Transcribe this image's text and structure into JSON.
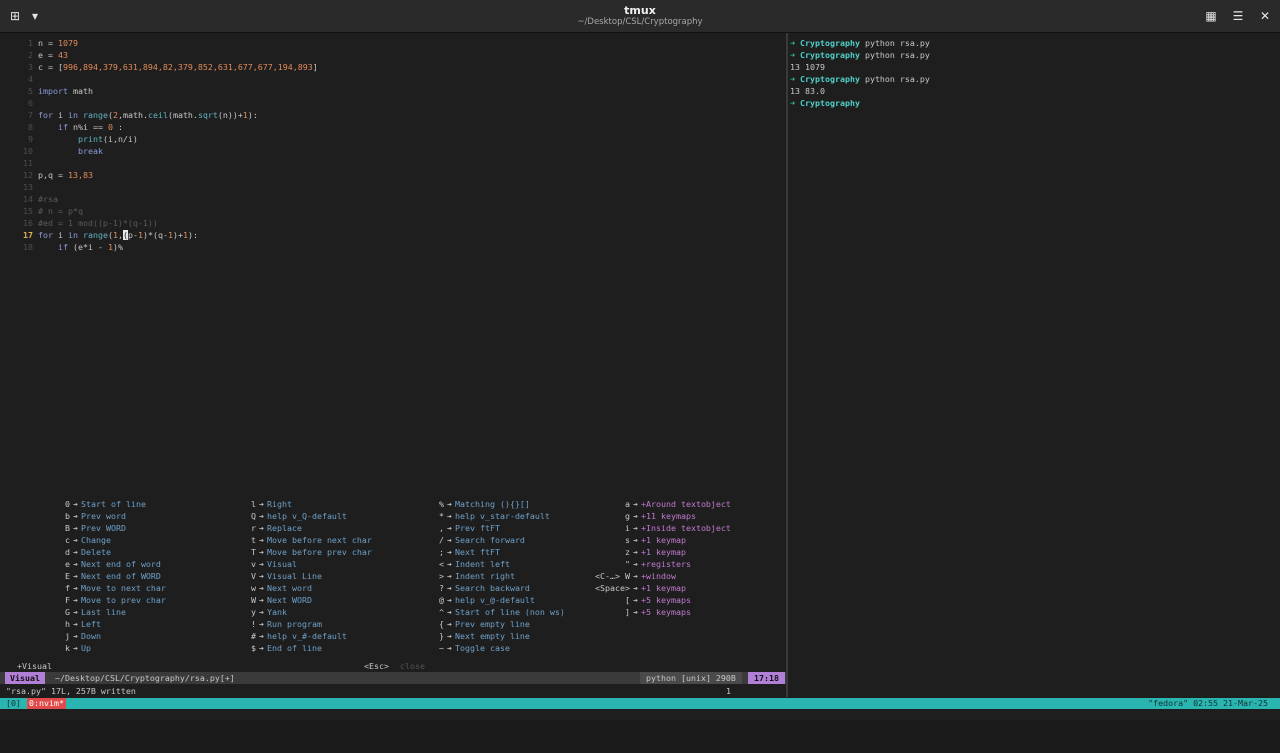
{
  "window": {
    "title": "tmux",
    "subtitle": "~/Desktop/CSL/Cryptography",
    "new_tab_icon": "plus-square-icon",
    "menu_icon": "chevron-down-icon",
    "grid_icon": "grid-icon",
    "hamburger_icon": "hamburger-icon",
    "close_icon": "close-icon",
    "new_tab_glyph": "⊞",
    "menu_glyph": "▾",
    "grid_glyph": "▦",
    "hamburger_glyph": "☰",
    "close_glyph": "✕"
  },
  "editor": {
    "lines": [
      {
        "num": "1",
        "html": "<span class='txt'>n = </span><span class='num'>1079</span>"
      },
      {
        "num": "2",
        "html": "<span class='txt'>e = </span><span class='num'>43</span>"
      },
      {
        "num": "3",
        "html": "<span class='txt'>c = [</span><span class='num'>996,894,379,631,894,82,379,852,631,677,677,194,893</span><span class='txt'>]</span>"
      },
      {
        "num": "4",
        "html": ""
      },
      {
        "num": "5",
        "html": "<span class='kw'>import</span><span class='txt'> math</span>"
      },
      {
        "num": "6",
        "html": ""
      },
      {
        "num": "7",
        "html": "<span class='kw'>for</span><span class='txt'> i </span><span class='kw'>in</span><span class='txt'> </span><span class='fn'>range</span><span class='txt'>(</span><span class='num'>2</span><span class='txt'>,math.</span><span class='fn'>ceil</span><span class='txt'>(math.</span><span class='fn'>sqrt</span><span class='txt'>(n))+</span><span class='num'>1</span><span class='txt'>):</span>"
      },
      {
        "num": "8",
        "html": "<span class='txt'>    </span><span class='kw'>if</span><span class='txt'> n%i == </span><span class='num'>0</span><span class='txt'> :</span>"
      },
      {
        "num": "9",
        "html": "<span class='txt'>        </span><span class='fn'>print</span><span class='txt'>(i,n/i)</span>"
      },
      {
        "num": "10",
        "html": "<span class='txt'>        </span><span class='kw'>break</span>"
      },
      {
        "num": "11",
        "html": ""
      },
      {
        "num": "12",
        "html": "<span class='txt'>p,q = </span><span class='num'>13,83</span>"
      },
      {
        "num": "13",
        "html": ""
      },
      {
        "num": "14",
        "html": "<span class='cm'>#rsa</span>"
      },
      {
        "num": "15",
        "html": "<span class='cm'># n = p*q</span>"
      },
      {
        "num": "16",
        "html": "<span class='cm'>#ed = 1 mod((p-1)*(q-1))</span>"
      },
      {
        "num": "17",
        "html": "<span class='kw'>for</span><span class='txt'> i </span><span class='kw'>in</span><span class='txt'> </span><span class='fn'>range</span><span class='txt'>(</span><span class='num'>1</span><span class='txt'>,</span><span class='cursor'>(</span><span class='txt'>p-</span><span class='num'>1</span><span class='txt'>)*(q-</span><span class='num'>1</span><span class='txt'>)+</span><span class='num'>1</span><span class='txt'>):</span>",
        "current": true
      },
      {
        "num": "18",
        "html": "<span class='txt'>    </span><span class='kw'>if</span><span class='txt'> (e*i - </span><span class='num'>1</span><span class='txt'>)%</span>"
      }
    ]
  },
  "which_key": {
    "columns": [
      [
        {
          "k": "0",
          "d": "Start of line"
        },
        {
          "k": "b",
          "d": "Prev word"
        },
        {
          "k": "B",
          "d": "Prev WORD"
        },
        {
          "k": "c",
          "d": "Change"
        },
        {
          "k": "d",
          "d": "Delete"
        },
        {
          "k": "e",
          "d": "Next end of word"
        },
        {
          "k": "E",
          "d": "Next end of WORD"
        },
        {
          "k": "f",
          "d": "Move to next char"
        },
        {
          "k": "F",
          "d": "Move to prev char"
        },
        {
          "k": "G",
          "d": "Last line"
        },
        {
          "k": "h",
          "d": "Left"
        },
        {
          "k": "j",
          "d": "Down"
        },
        {
          "k": "k",
          "d": "Up"
        }
      ],
      [
        {
          "k": "l",
          "d": "Right"
        },
        {
          "k": "Q",
          "d": "help v_Q-default"
        },
        {
          "k": "r",
          "d": "Replace"
        },
        {
          "k": "t",
          "d": "Move before next char"
        },
        {
          "k": "T",
          "d": "Move before prev char"
        },
        {
          "k": "v",
          "d": "Visual"
        },
        {
          "k": "V",
          "d": "Visual Line"
        },
        {
          "k": "w",
          "d": "Next word"
        },
        {
          "k": "W",
          "d": "Next WORD"
        },
        {
          "k": "y",
          "d": "Yank"
        },
        {
          "k": "!",
          "d": "Run program"
        },
        {
          "k": "#",
          "d": "help v_#-default"
        },
        {
          "k": "$",
          "d": "End of line"
        }
      ],
      [
        {
          "k": "%",
          "d": "Matching (){}[]"
        },
        {
          "k": "*",
          "d": "help v_star-default"
        },
        {
          "k": ",",
          "d": "Prev ftFT"
        },
        {
          "k": "/",
          "d": "Search forward"
        },
        {
          "k": ";",
          "d": "Next ftFT"
        },
        {
          "k": "<",
          "d": "Indent left"
        },
        {
          "k": ">",
          "d": "Indent right"
        },
        {
          "k": "?",
          "d": "Search backward"
        },
        {
          "k": "@",
          "d": "help v_@-default"
        },
        {
          "k": "^",
          "d": "Start of line (non ws)"
        },
        {
          "k": "{",
          "d": "Prev empty line"
        },
        {
          "k": "}",
          "d": "Next empty line"
        },
        {
          "k": "~",
          "d": "Toggle case"
        }
      ],
      [
        {
          "k": "a",
          "d": "+Around textobject",
          "g": true
        },
        {
          "k": "g",
          "d": "+11 keymaps",
          "g": true
        },
        {
          "k": "i",
          "d": "+Inside textobject",
          "g": true
        },
        {
          "k": "s",
          "d": "+1 keymap",
          "g": true
        },
        {
          "k": "z",
          "d": "+1 keymap",
          "g": true
        },
        {
          "k": "\"",
          "d": "+registers",
          "g": true
        },
        {
          "k": "<C-…> W",
          "d": "+window",
          "g": true
        },
        {
          "k": "<Space>",
          "d": "+1 keymap",
          "g": true
        },
        {
          "k": "[",
          "d": "+5 keymaps",
          "g": true
        },
        {
          "k": "]",
          "d": "+5 keymaps",
          "g": true
        }
      ]
    ],
    "footer_left": "+Visual",
    "footer_esc": "<Esc>",
    "footer_close": "close",
    "arrow": "➔"
  },
  "statusline": {
    "mode": "Visual",
    "path": "~/Desktop/CSL/Cryptography/rsa.py[+]",
    "filetype": "python [unix] 290B",
    "position": "17:18"
  },
  "cmdline": {
    "message": "\"rsa.py\" 17L, 257B written",
    "count": "1"
  },
  "shell": {
    "arrow": "➜",
    "lines": [
      {
        "dir": "Cryptography",
        "cmd": " python rsa.py"
      },
      {
        "dir": "Cryptography",
        "cmd": " python rsa.py"
      },
      {
        "out": "13 1079"
      },
      {
        "dir": "Cryptography",
        "cmd": " python rsa.py"
      },
      {
        "out": "13 83.0"
      },
      {
        "dir": "Cryptography",
        "cmd": ""
      }
    ]
  },
  "tmux": {
    "session": "[0]",
    "window": "0:nvim*",
    "right": "\"fedora\" 02:55 21-Mar-25"
  }
}
